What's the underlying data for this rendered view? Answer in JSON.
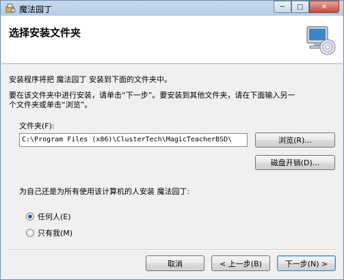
{
  "window": {
    "title": "魔法园丁",
    "minimize_glyph": "─",
    "maximize_glyph": "□",
    "close_glyph": "✕"
  },
  "header": {
    "title": "选择安装文件夹",
    "icon": "computer-cd-icon"
  },
  "body": {
    "intro": "安装程序将把 魔法园丁 安装到下面的文件夹中。",
    "instruction_line1": "要在该文件夹中进行安装，请单击“下一步”。要安装到其他文件夹，请在下面输入另一",
    "instruction_line2": "个文件夹或单击“浏览”。",
    "folder_label": "文件夹(F):",
    "folder_path": "C:\\Program Files (x86)\\ClusterTech\\MagicTeacherBSD\\",
    "browse_button": "浏览(R)...",
    "disk_cost_button": "磁盘开销(D)...",
    "who_question": "为自己还是为所有使用该计算机的人安装 魔法园丁:",
    "options": [
      {
        "label": "任何人(E)",
        "selected": true
      },
      {
        "label": "只有我(M)",
        "selected": false
      }
    ]
  },
  "footer": {
    "cancel_button": "取消",
    "back_button": "< 上一步(B)",
    "next_button": "下一步(N) >"
  }
}
